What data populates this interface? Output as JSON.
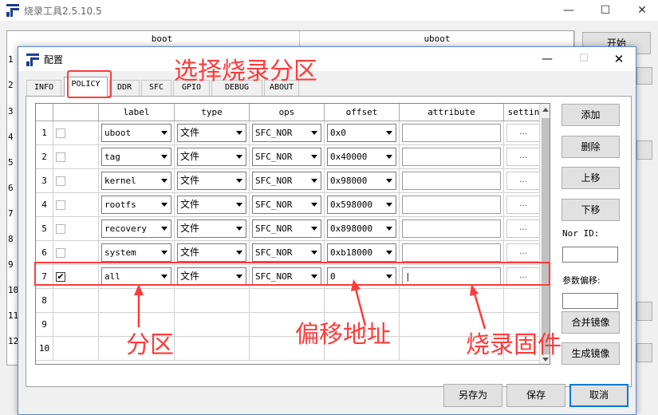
{
  "app": {
    "title": "烧录工具2.5.10.5",
    "start_button": "开始",
    "grid_headers": [
      "boot",
      "uboot"
    ],
    "row_numbers": [
      "1",
      "2",
      "3",
      "4",
      "5",
      "6",
      "7",
      "8",
      "9",
      "10",
      "11",
      "12"
    ]
  },
  "dialog": {
    "title": "配置",
    "tabs": [
      "INFO",
      "POLICY",
      "DDR",
      "SFC",
      "GPIO",
      "DEBUG",
      "ABOUT"
    ],
    "active_tab": "POLICY",
    "columns": [
      "label",
      "type",
      "ops",
      "offset",
      "attribute",
      "settin"
    ],
    "rows": [
      {
        "num": "1",
        "checked": false,
        "label": "uboot",
        "type": "文件",
        "ops": "SFC_NOR",
        "offset": "0x0",
        "attribute": "",
        "setting": "..."
      },
      {
        "num": "2",
        "checked": false,
        "label": "tag",
        "type": "文件",
        "ops": "SFC_NOR",
        "offset": "0x40000",
        "attribute": "",
        "setting": "..."
      },
      {
        "num": "3",
        "checked": false,
        "label": "kernel",
        "type": "文件",
        "ops": "SFC_NOR",
        "offset": "0x98000",
        "attribute": "",
        "setting": "..."
      },
      {
        "num": "4",
        "checked": false,
        "label": "rootfs",
        "type": "文件",
        "ops": "SFC_NOR",
        "offset": "0x598000",
        "attribute": "",
        "setting": "..."
      },
      {
        "num": "5",
        "checked": false,
        "label": "recovery",
        "type": "文件",
        "ops": "SFC_NOR",
        "offset": "0x898000",
        "attribute": "",
        "setting": "..."
      },
      {
        "num": "6",
        "checked": false,
        "label": "system",
        "type": "文件",
        "ops": "SFC_NOR",
        "offset": "0xb18000",
        "attribute": "",
        "setting": "..."
      },
      {
        "num": "7",
        "checked": true,
        "label": "all",
        "type": "文件",
        "ops": "SFC_NOR",
        "offset": "0",
        "attribute": "|",
        "setting": "..."
      }
    ],
    "empty_rows": [
      "8",
      "9",
      "10"
    ],
    "side": {
      "add": "添加",
      "delete": "删除",
      "move_up": "上移",
      "move_down": "下移",
      "nor_id_label": "Nor ID:",
      "param_offset_label": "参数偏移:",
      "merge_image": "合并镜像",
      "generate_image": "生成镜像"
    },
    "footer": {
      "save_as": "另存为",
      "save": "保存",
      "cancel": "取消"
    }
  },
  "annotations": {
    "select_partition": "选择烧录分区",
    "partition": "分区",
    "offset_address": "偏移地址",
    "burn_firmware": "烧录固件",
    "color": "#ff3b3b"
  }
}
